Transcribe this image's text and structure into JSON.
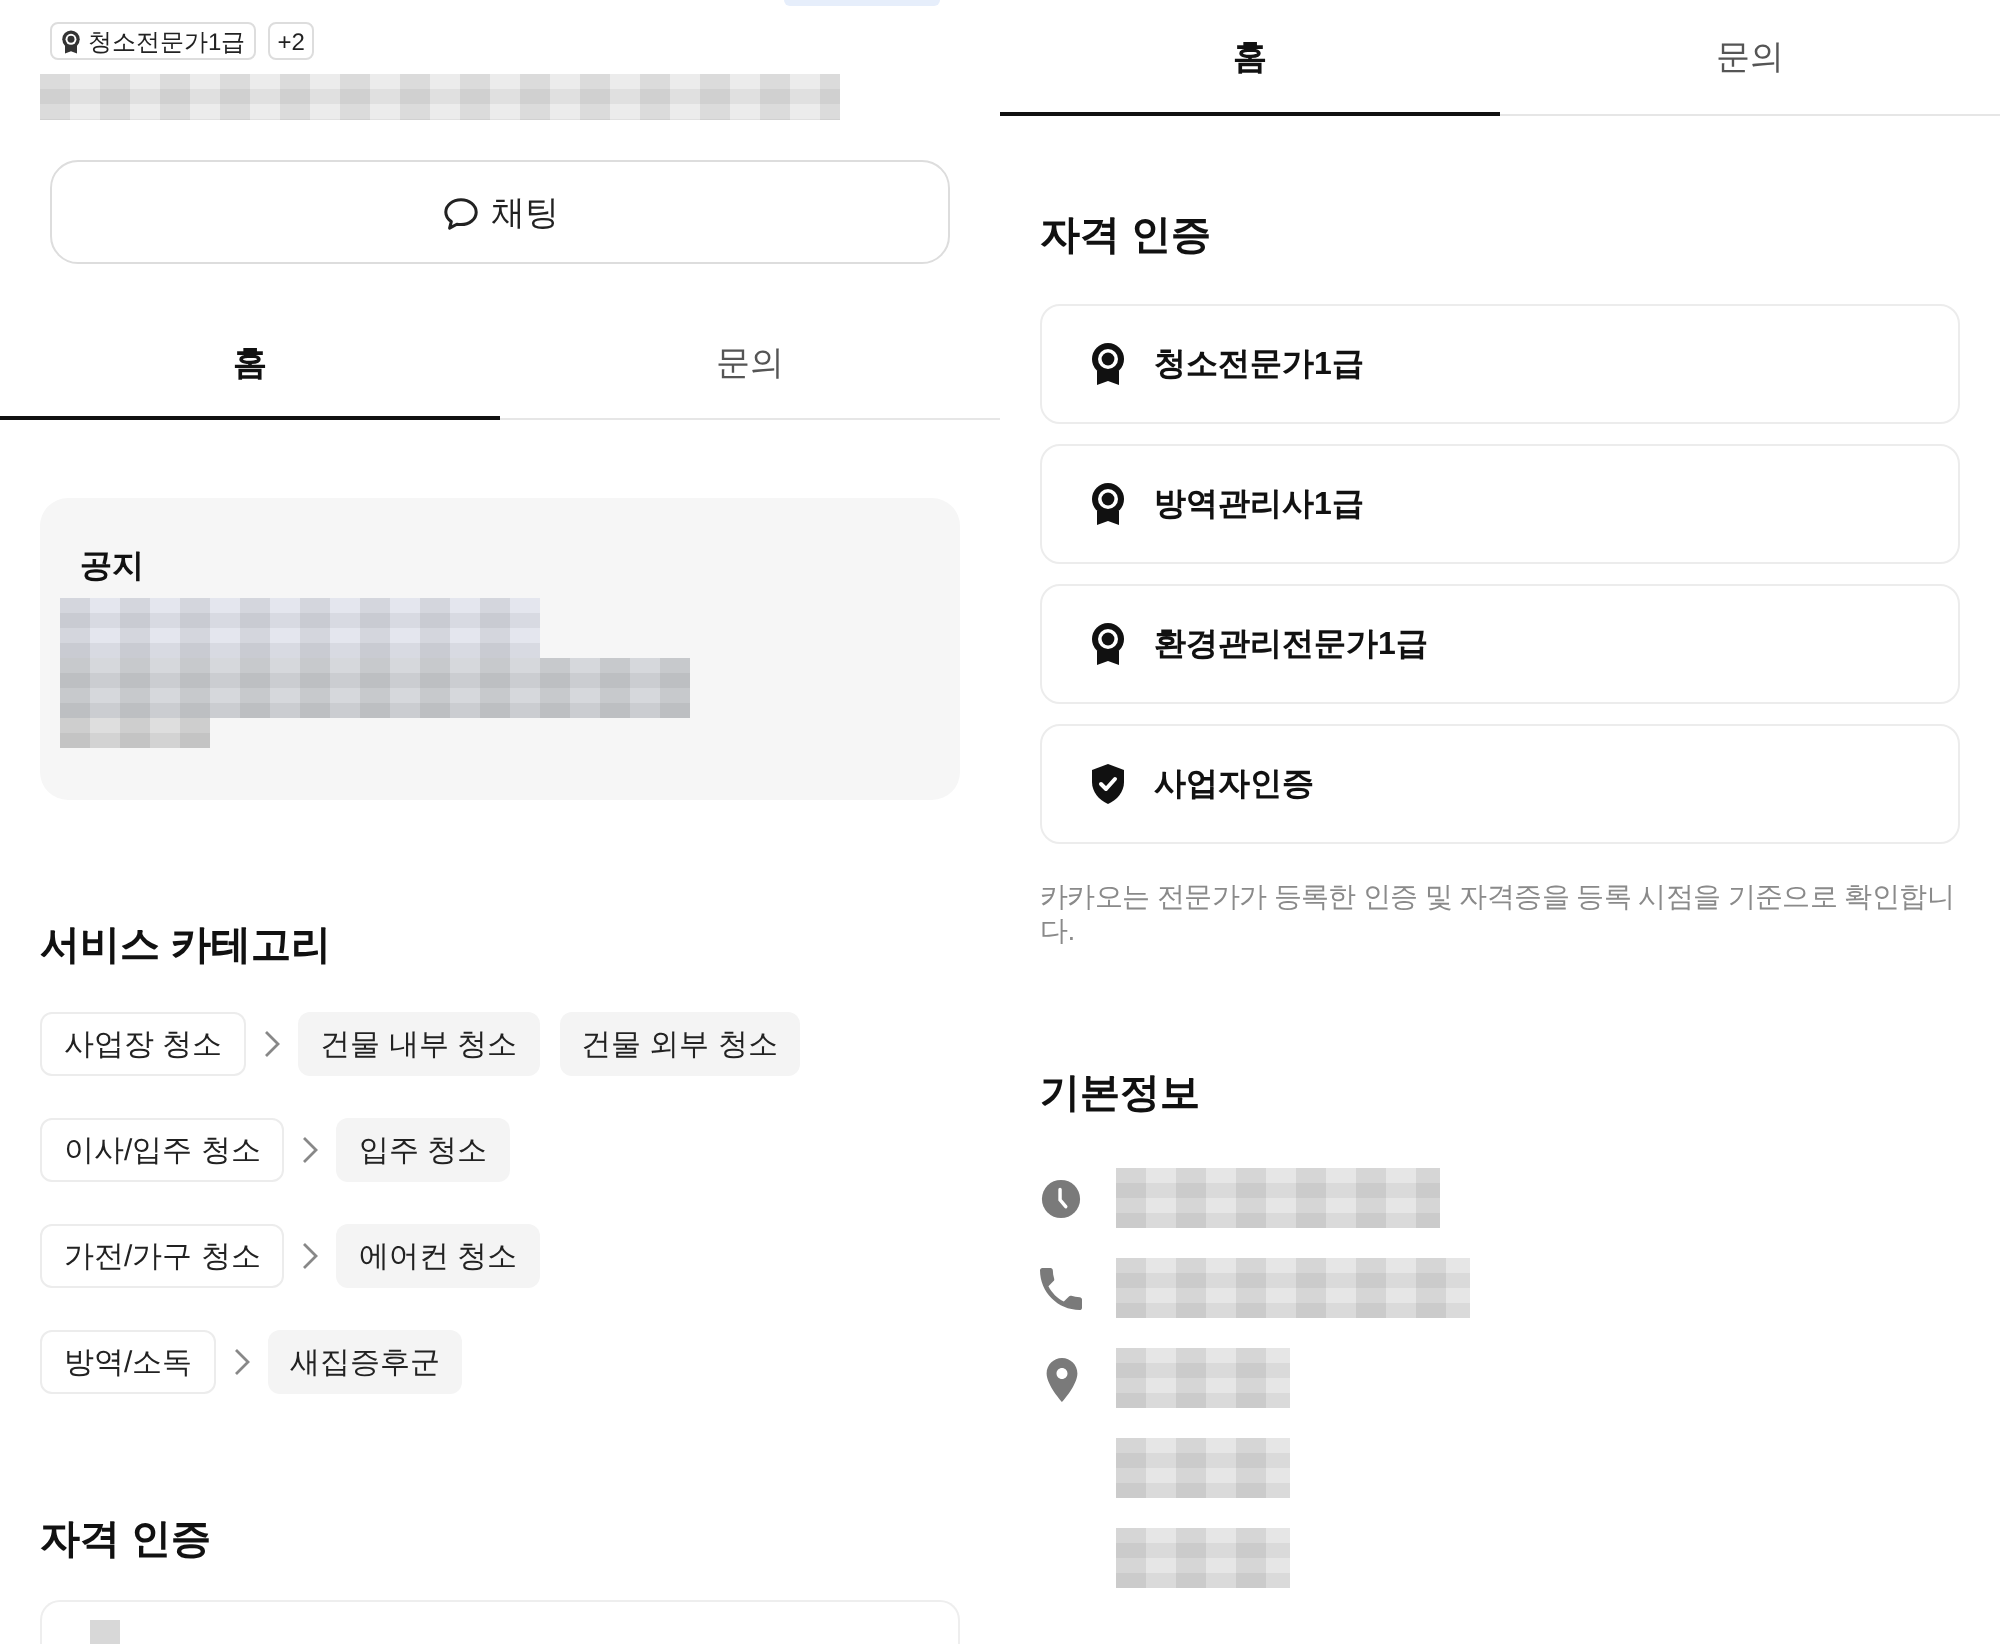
{
  "left_panel": {
    "badges": [
      {
        "kind": "certificate",
        "label": "청소전문가1급"
      },
      {
        "kind": "count",
        "label": "+2"
      }
    ],
    "chat_button": {
      "label": "채팅"
    },
    "tabs": [
      {
        "label": "홈",
        "selected": true
      },
      {
        "label": "문의",
        "selected": false
      }
    ],
    "notice": {
      "title": "공지"
    },
    "service_category": {
      "title": "서비스 카테고리",
      "rows": [
        {
          "parent": "사업장 청소",
          "subcategories": [
            "건물 내부 청소",
            "건물 외부 청소"
          ]
        },
        {
          "parent": "이사/입주 청소",
          "subcategories": [
            "입주 청소"
          ]
        },
        {
          "parent": "가전/가구 청소",
          "subcategories": [
            "에어컨 청소"
          ]
        },
        {
          "parent": "방역/소독",
          "subcategories": [
            "새집증후군"
          ]
        }
      ]
    },
    "certifications": {
      "title": "자격 인증"
    }
  },
  "right_panel": {
    "tabs": [
      {
        "label": "홈",
        "selected": true
      },
      {
        "label": "문의",
        "selected": false
      }
    ],
    "certifications": {
      "title": "자격 인증",
      "items": [
        {
          "kind": "license",
          "label": "청소전문가1급"
        },
        {
          "kind": "license",
          "label": "방역관리사1급"
        },
        {
          "kind": "license",
          "label": "환경관리전문가1급"
        },
        {
          "kind": "business",
          "label": "사업자인증"
        }
      ],
      "note": "카카오는 전문가가 등록한 인증 및 자격증을 등록 시점을 기준으로 확인합니다."
    },
    "basic_info": {
      "title": "기본정보",
      "rows": [
        {
          "kind": "hours"
        },
        {
          "kind": "phone"
        },
        {
          "kind": "address"
        }
      ]
    }
  }
}
